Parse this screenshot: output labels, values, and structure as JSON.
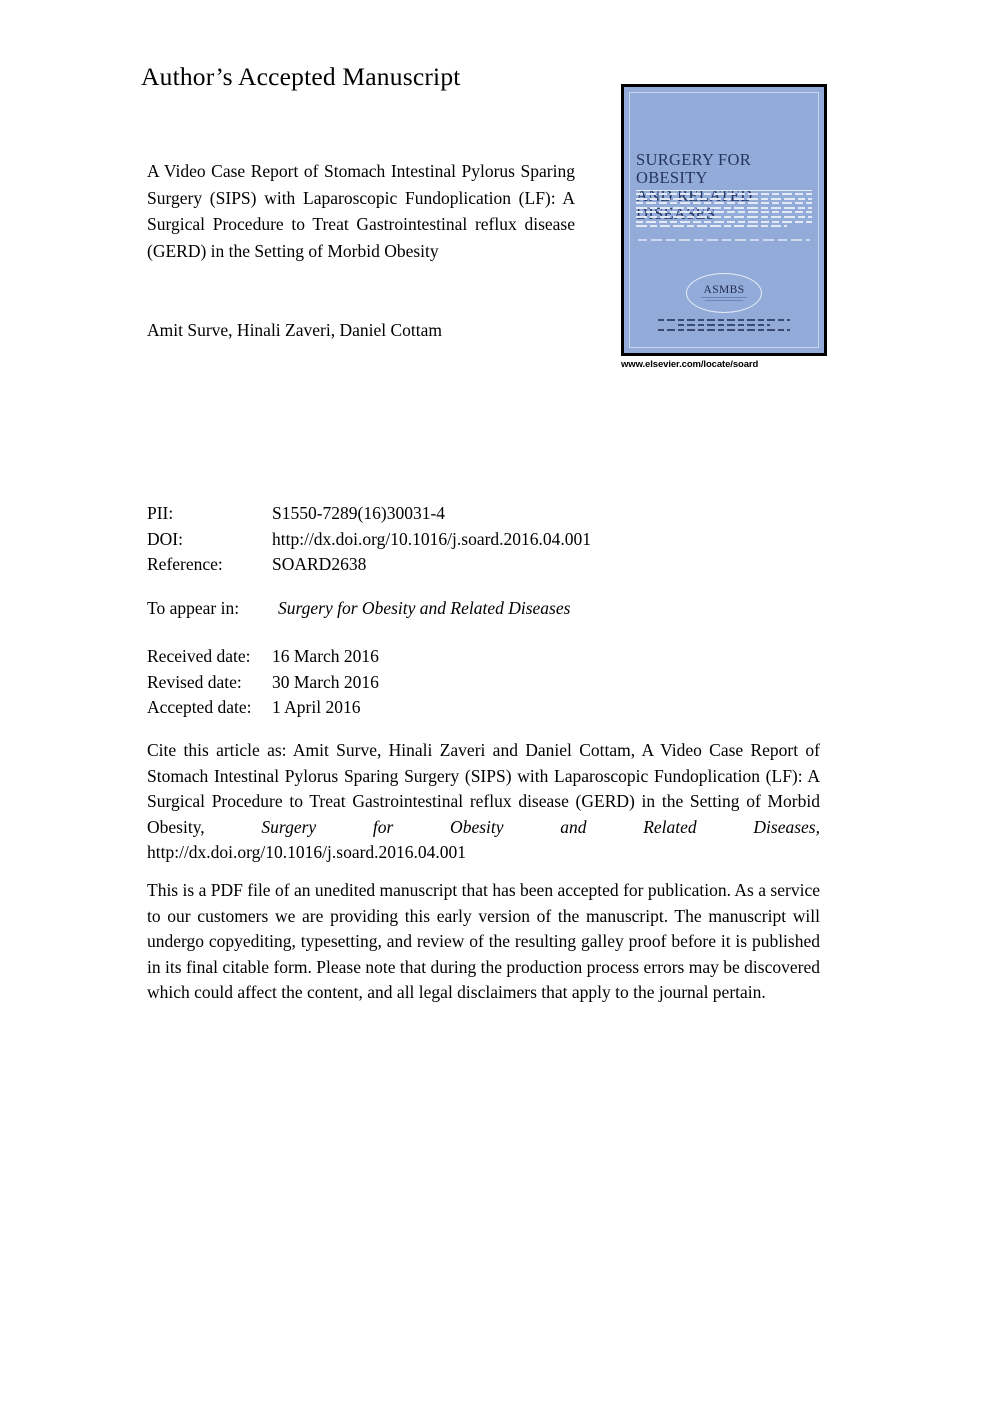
{
  "header": {
    "accepted_manuscript_label": "Author’s Accepted Manuscript"
  },
  "article": {
    "title": "A Video Case Report of Stomach Intestinal Pylorus Sparing Surgery (SIPS) with Laparoscopic Fundoplication (LF): A Surgical Procedure to Treat Gastrointestinal reflux disease (GERD) in the Setting of Morbid Obesity",
    "title_lines": [
      "A Video Case Report of Stomach Intestinal Pylorus",
      "Sparing Surgery (SIPS) with Laparoscopic",
      "Fundoplication (LF): A Surgical Procedure to Treat",
      "Gastrointestinal reflux disease (GERD) in the",
      "Setting of Morbid Obesity"
    ],
    "authors": "Amit Surve, Hinali Zaveri, Daniel Cottam"
  },
  "cover": {
    "journal_title_line1": "SURGERY FOR OBESITY",
    "journal_title_line2": "AND RELATED DISEASES",
    "society_logo_text": "ASMBS",
    "publisher_url": "www.elsevier.com/locate/soard",
    "background_color": "#93abd8",
    "title_color": "#26355f",
    "border_color": "#000000"
  },
  "metadata": {
    "rows": [
      {
        "label": "PII:",
        "value": "S1550-7289(16)30031-4"
      },
      {
        "label": "DOI:",
        "value": "http://dx.doi.org/10.1016/j.soard.2016.04.001"
      },
      {
        "label": "Reference:",
        "value": "SOARD2638"
      }
    ],
    "to_appear_in": {
      "label": "To appear in:",
      "value": "Surgery for Obesity and Related Diseases"
    },
    "dates": [
      {
        "label": "Received date:",
        "value": "16 March 2016"
      },
      {
        "label": "Revised date:",
        "value": "30 March 2016"
      },
      {
        "label": "Accepted date:",
        "value": "1 April 2016"
      }
    ]
  },
  "citation": {
    "full_text": "Cite this article as: Amit Surve, Hinali Zaveri and Daniel Cottam, A Video Case Report of Stomach Intestinal Pylorus Sparing Surgery (SIPS) with Laparoscopic Fundoplication (LF): A Surgical Procedure to Treat Gastrointestinal reflux disease (GERD) in the Setting of Morbid Obesity, Surgery for Obesity and Related Diseases, http://dx.doi.org/10.1016/j.soard.2016.04.001",
    "lead": "Cite this article as: Amit Surve, Hinali Zaveri and Daniel Cottam, A Video Case Report of Stomach Intestinal Pylorus Sparing Surgery (SIPS) with Laparoscopic Fundoplication (LF): A Surgical Procedure to Treat Gastrointestinal reflux disease (GERD) in the Setting of Morbid Obesity,",
    "journal_italic": "Surgery for Obesity and Related Diseases,",
    "doi": "http://dx.doi.org/10.1016/j.soard.2016.04.001"
  },
  "disclaimer": {
    "text": "This is a PDF file of an unedited manuscript that has been accepted for publication. As a service to our customers we are providing this early version of the manuscript. The manuscript will undergo copyediting, typesetting, and review of the resulting galley proof before it is published in its final citable form. Please note that during the production process errors may be discovered which could affect the content, and all legal disclaimers that apply to the journal pertain."
  }
}
